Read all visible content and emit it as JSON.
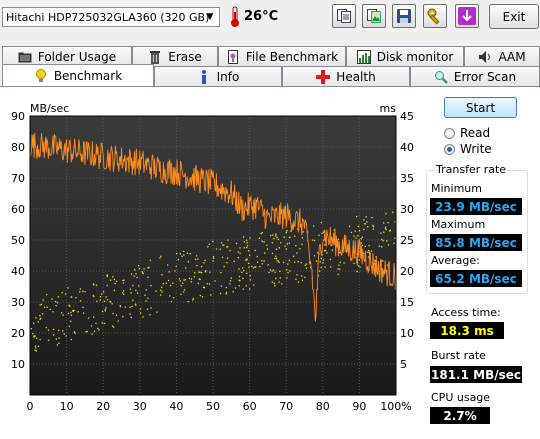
{
  "toolbar": {
    "drive_name": "Hitachi HDP725032GLA360 (320 GB)",
    "temperature": "26°C",
    "exit_label": "Exit"
  },
  "tabs_top": [
    "Folder Usage",
    "Erase",
    "File Benchmark",
    "Disk monitor",
    "AAM"
  ],
  "tabs_bottom": [
    "Benchmark",
    "Info",
    "Health",
    "Error Scan"
  ],
  "active_tab": "Benchmark",
  "controls": {
    "start_label": "Start",
    "read_label": "Read",
    "write_label": "Write",
    "mode_selected": "Write"
  },
  "stats": {
    "transfer_rate_title": "Transfer rate",
    "minimum_label": "Minimum",
    "minimum_value": "23.9 MB/sec",
    "maximum_label": "Maximum",
    "maximum_value": "85.8 MB/sec",
    "average_label": "Average:",
    "average_value": "65.2 MB/sec",
    "access_time_label": "Access time:",
    "access_time_value": "18.3 ms",
    "burst_rate_label": "Burst rate",
    "burst_rate_value": "181.1 MB/sec",
    "cpu_usage_label": "CPU usage",
    "cpu_usage_value": "2.7%"
  },
  "colors": {
    "chart_bg_top": "#3b3b3b",
    "chart_bg_bottom": "#1a1a1a",
    "grid": "#555555",
    "transfer_line": "#ff8c1a",
    "access_dots": "#e6e600",
    "value_blue": "#2aa6f0",
    "value_yellow": "#ffff00"
  },
  "chart_data": {
    "type": "line",
    "left_axis_label": "MB/sec",
    "right_axis_label": "ms",
    "x_tick_labels": [
      "0",
      "10",
      "20",
      "30",
      "40",
      "50",
      "60",
      "70",
      "80",
      "90",
      "100%"
    ],
    "y_tick_labels": [
      "90",
      "80",
      "70",
      "60",
      "50",
      "40",
      "30",
      "20",
      "10"
    ],
    "y2_tick_labels": [
      "45",
      "40",
      "35",
      "30",
      "25",
      "20",
      "15",
      "10",
      "5"
    ],
    "xlim": [
      0,
      100
    ],
    "ylim": [
      0,
      90
    ],
    "y2lim": [
      0,
      45
    ],
    "grid": true,
    "series": [
      {
        "name": "Transfer rate",
        "unit": "MB/sec",
        "x": [
          0,
          5,
          10,
          15,
          20,
          25,
          30,
          35,
          40,
          45,
          50,
          55,
          58,
          60,
          62,
          65,
          70,
          75,
          77,
          78,
          79,
          80,
          85,
          90,
          95,
          100
        ],
        "y": [
          81,
          80,
          79,
          78,
          77,
          76,
          75,
          73,
          72,
          70,
          68,
          65,
          60,
          61,
          61,
          57,
          58,
          55,
          40,
          24,
          45,
          52,
          48,
          46,
          41,
          38
        ]
      },
      {
        "name": "Access time",
        "unit": "ms",
        "x": [
          0,
          10,
          20,
          30,
          40,
          50,
          60,
          70,
          80,
          90,
          100
        ],
        "y": [
          11,
          13,
          15,
          17,
          19,
          20.5,
          21.5,
          22.5,
          23.5,
          24.5,
          25.5
        ]
      }
    ]
  }
}
